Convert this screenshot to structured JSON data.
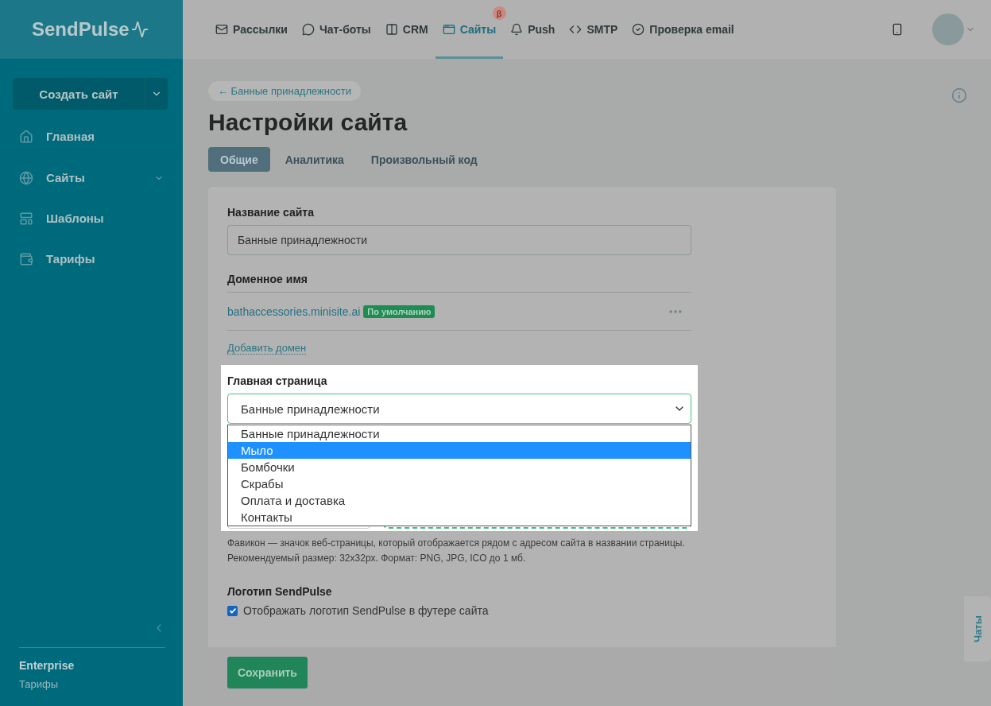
{
  "header": {
    "logo": "SendPulse",
    "nav": [
      {
        "kind": "mail",
        "label": "Рассылки",
        "selected": false
      },
      {
        "kind": "chat",
        "label": "Чат-боты",
        "selected": false
      },
      {
        "kind": "crm",
        "label": "CRM",
        "selected": false
      },
      {
        "kind": "sites",
        "label": "Сайты",
        "selected": true,
        "badge": "β"
      },
      {
        "kind": "push",
        "label": "Push",
        "selected": false
      },
      {
        "kind": "smtp",
        "label": "SMTP",
        "selected": false
      },
      {
        "kind": "verify",
        "label": "Проверка email",
        "selected": false
      }
    ]
  },
  "sidebar": {
    "create_button": "Создать сайт",
    "items": [
      {
        "kind": "home",
        "label": "Главная",
        "has_submenu": false
      },
      {
        "kind": "sites",
        "label": "Сайты",
        "has_submenu": true
      },
      {
        "kind": "templates",
        "label": "Шаблоны",
        "has_submenu": false
      },
      {
        "kind": "pricing",
        "label": "Тарифы",
        "has_submenu": false
      }
    ],
    "plan": "Enterprise",
    "plan_link": "Тарифы"
  },
  "breadcrumb": "← Банные принадлежности",
  "title": "Настройки сайта",
  "tabs": [
    {
      "label": "Общие",
      "selected": true
    },
    {
      "label": "Аналитика",
      "selected": false
    },
    {
      "label": "Произвольный код",
      "selected": false
    }
  ],
  "form": {
    "site_name": {
      "label": "Название сайта",
      "value": "Банные принадлежности"
    },
    "domain": {
      "label": "Доменное имя",
      "name": "bathaccessories.minisite.ai",
      "badge": "По умолчанию"
    },
    "add_domain": "Добавить домен",
    "home_page": {
      "label": "Главная страница",
      "value": "Банные принадлежности",
      "options": [
        {
          "label": "Банные принадлежности",
          "highlighted": false
        },
        {
          "label": "Мыло",
          "highlighted": true
        },
        {
          "label": "Бомбочки",
          "highlighted": false
        },
        {
          "label": "Скрабы",
          "highlighted": false
        },
        {
          "label": "Оплата и доставка",
          "highlighted": false
        },
        {
          "label": "Контакты",
          "highlighted": false
        }
      ]
    },
    "favicon_hint": "Фавикон — значок веб-страницы, который отображается рядом с адресом сайта в названии страницы. Рекомендуемый размер: 32x32px. Формат: PNG, JPG, ICO до 1 мб.",
    "logo": {
      "label": "Логотип SendPulse",
      "checkbox": "Отображать логотип SendPulse в футере сайта",
      "checked": true
    },
    "save": "Сохранить"
  },
  "chat_tab": "Чаты"
}
